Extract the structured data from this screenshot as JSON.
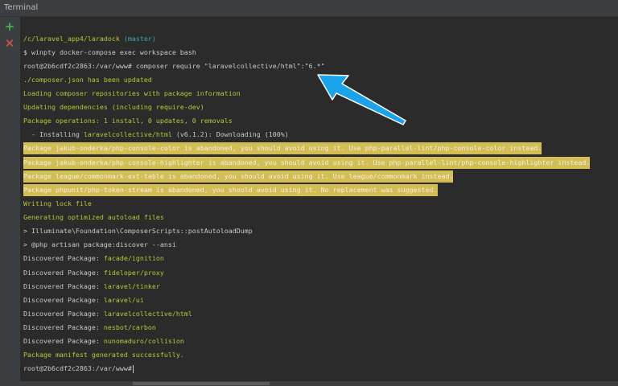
{
  "window": {
    "title": "Terminal"
  },
  "toolbar": {
    "new_session_icon": "plus-icon",
    "close_session_icon": "close-icon"
  },
  "colors": {
    "yellow": "#b8c53a",
    "cyan": "#3fa8a8",
    "highlight": "#d3bd55",
    "arrow": "#1aa3e8"
  },
  "lines": [
    {
      "parts": [
        {
          "t": "/c/laravel_app4/laradock ",
          "c": "y"
        },
        {
          "t": "(master)",
          "c": "c"
        }
      ]
    },
    {
      "parts": [
        {
          "t": "$ winpty docker-compose exec workspace bash",
          "c": "g"
        }
      ]
    },
    {
      "parts": [
        {
          "t": "root@2b6cdf2c2863:/var/www# composer require \"laravelcollective/html\":\"6.*\"",
          "c": "g"
        }
      ]
    },
    {
      "parts": [
        {
          "t": "./composer.json has been updated",
          "c": "y"
        }
      ]
    },
    {
      "parts": [
        {
          "t": "Loading composer repositories with package information",
          "c": "y"
        }
      ]
    },
    {
      "parts": [
        {
          "t": "Updating dependencies (including require-dev)",
          "c": "y"
        }
      ]
    },
    {
      "parts": [
        {
          "t": "Package operations: 1 install, 0 updates, 0 removals",
          "c": "y"
        }
      ]
    },
    {
      "parts": [
        {
          "t": "  - Installing ",
          "c": "g"
        },
        {
          "t": "laravelcollective/html",
          "c": "y"
        },
        {
          "t": " (v6.1.2): Downloading (100%)",
          "c": "g"
        }
      ]
    },
    {
      "parts": [
        {
          "t": "Package jakub-onderka/php-console-color is abandoned, you should avoid using it. Use php-parallel-lint/php-console-color instead.",
          "c": "hl"
        }
      ]
    },
    {
      "parts": [
        {
          "t": "Package jakub-onderka/php-console-highlighter is abandoned, you should avoid using it. Use php-parallel-lint/php-console-highlighter instead.",
          "c": "hl"
        }
      ]
    },
    {
      "parts": [
        {
          "t": "Package league/commonmark-ext-table is abandoned, you should avoid using it. Use league/commonmark instead.",
          "c": "hl"
        }
      ]
    },
    {
      "parts": [
        {
          "t": "Package phpunit/php-token-stream is abandoned, you should avoid using it. No replacement was suggested.",
          "c": "hl"
        }
      ]
    },
    {
      "parts": [
        {
          "t": "Writing lock file",
          "c": "y"
        }
      ]
    },
    {
      "parts": [
        {
          "t": "Generating optimized autoload files",
          "c": "y"
        }
      ]
    },
    {
      "parts": [
        {
          "t": "> Illuminate\\Foundation\\ComposerScripts::postAutoloadDump",
          "c": "g"
        }
      ]
    },
    {
      "parts": [
        {
          "t": "> @php artisan package:discover --ansi",
          "c": "g"
        }
      ]
    },
    {
      "parts": [
        {
          "t": "Discovered Package: ",
          "c": "g"
        },
        {
          "t": "facade/ignition",
          "c": "y"
        }
      ]
    },
    {
      "parts": [
        {
          "t": "Discovered Package: ",
          "c": "g"
        },
        {
          "t": "fideloper/proxy",
          "c": "y"
        }
      ]
    },
    {
      "parts": [
        {
          "t": "Discovered Package: ",
          "c": "g"
        },
        {
          "t": "laravel/tinker",
          "c": "y"
        }
      ]
    },
    {
      "parts": [
        {
          "t": "Discovered Package: ",
          "c": "g"
        },
        {
          "t": "laravel/ui",
          "c": "y"
        }
      ]
    },
    {
      "parts": [
        {
          "t": "Discovered Package: ",
          "c": "g"
        },
        {
          "t": "laravelcollective/html",
          "c": "y"
        }
      ]
    },
    {
      "parts": [
        {
          "t": "Discovered Package: ",
          "c": "g"
        },
        {
          "t": "nesbot/carbon",
          "c": "y"
        }
      ]
    },
    {
      "parts": [
        {
          "t": "Discovered Package: ",
          "c": "g"
        },
        {
          "t": "nunomaduro/collision",
          "c": "y"
        }
      ]
    },
    {
      "parts": [
        {
          "t": "Package manifest generated successfully.",
          "c": "y"
        }
      ]
    },
    {
      "parts": [
        {
          "t": "root@2b6cdf2c2863:/var/www# ",
          "c": "g"
        }
      ]
    }
  ]
}
